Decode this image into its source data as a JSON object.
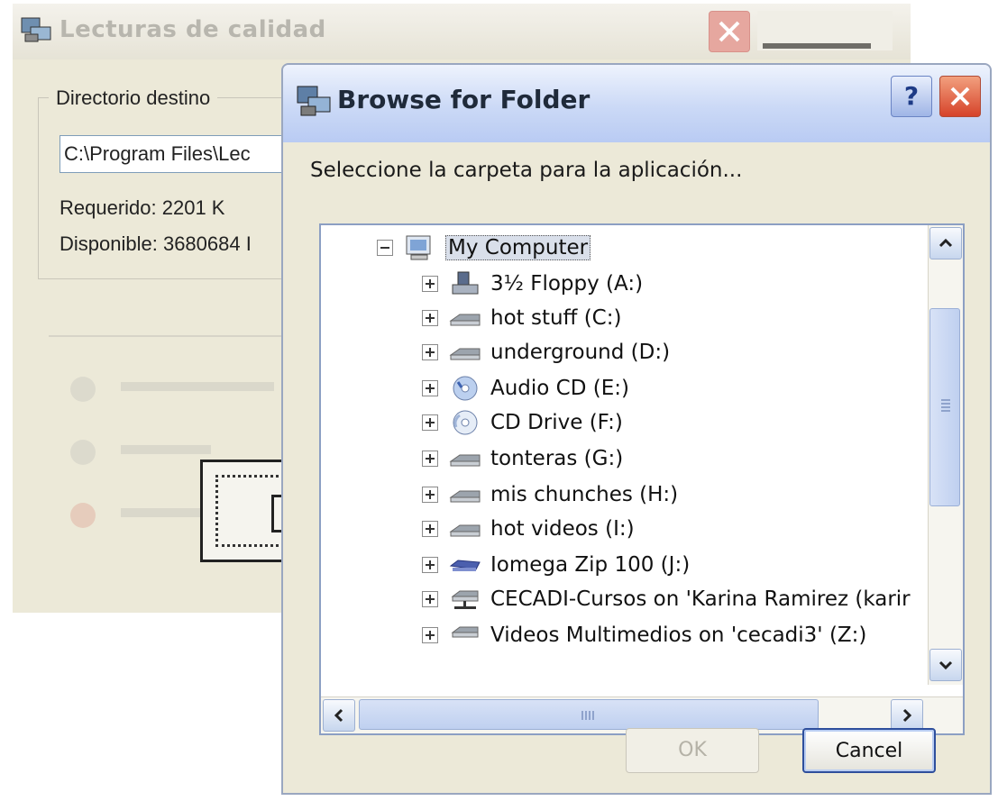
{
  "background_window": {
    "title": "Lecturas de calidad",
    "group_label": "Directorio destino",
    "path_value": "C:\\Program Files\\Lec",
    "required": "Requerido: 2201 K",
    "available": "Disponible: 3680684 I"
  },
  "dialog": {
    "title": "Browse for Folder",
    "help_label": "?",
    "prompt": "Seleccione la carpeta para la aplicación...",
    "tree": [
      {
        "label": "My Computer",
        "icon": "computer-icon",
        "expanded": true,
        "selected": true
      },
      {
        "label": "3½ Floppy (A:)",
        "icon": "floppy-icon"
      },
      {
        "label": "hot stuff (C:)",
        "icon": "hard-drive-icon"
      },
      {
        "label": "underground (D:)",
        "icon": "hard-drive-icon"
      },
      {
        "label": "Audio CD (E:)",
        "icon": "audio-cd-icon"
      },
      {
        "label": "CD Drive (F:)",
        "icon": "cd-drive-icon"
      },
      {
        "label": "tonteras (G:)",
        "icon": "hard-drive-icon"
      },
      {
        "label": "mis chunches (H:)",
        "icon": "hard-drive-icon"
      },
      {
        "label": "hot videos (I:)",
        "icon": "hard-drive-icon"
      },
      {
        "label": "Iomega Zip 100 (J:)",
        "icon": "zip-drive-icon"
      },
      {
        "label": "CECADI-Cursos on 'Karina Ramirez (karir",
        "icon": "network-drive-icon"
      },
      {
        "label": "Videos Multimedios on 'cecadi3' (Z:)",
        "icon": "network-drive-icon"
      }
    ],
    "ok_label": "OK",
    "cancel_label": "Cancel"
  }
}
